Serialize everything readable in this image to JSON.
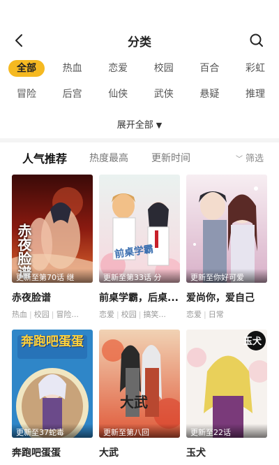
{
  "header": {
    "title": "分类",
    "back_icon": "chevron-left-icon",
    "search_icon": "search-icon"
  },
  "categories": {
    "row1": [
      "全部",
      "热血",
      "恋爱",
      "校园",
      "百合",
      "彩虹"
    ],
    "row2": [
      "冒险",
      "后宫",
      "仙侠",
      "武侠",
      "悬疑",
      "推理"
    ],
    "active": "全部",
    "active_color": "#f5b921"
  },
  "expand": {
    "label": "展开全部",
    "icon": "triangle-down-icon"
  },
  "sort": {
    "tabs": [
      "人气推荐",
      "热度最高",
      "更新时间"
    ],
    "active": "人气推荐",
    "filter_label": "筛选",
    "filter_icon": "chevron-down-icon"
  },
  "comics": [
    {
      "title": "赤夜脸谱",
      "caption": "更新至第70话 继",
      "tags": [
        "热血",
        "校园",
        "冒险..."
      ],
      "cover_text": "赤夜脸谱"
    },
    {
      "title": "前桌学霸，后桌...",
      "caption": "更新至第33话 分",
      "tags": [
        "恋爱",
        "校园",
        "搞笑..."
      ],
      "cover_text": "前桌学霸"
    },
    {
      "title": "爱尚你，爱自己",
      "caption": "更新至你好可爱",
      "tags": [
        "恋爱",
        "日常"
      ],
      "cover_text": ""
    },
    {
      "title": "奔跑吧蛋蛋",
      "caption": "更新至37蛇毒",
      "tags": [],
      "cover_text": "奔跑吧蛋蛋"
    },
    {
      "title": "大武",
      "caption": "更新至第八回",
      "tags": [],
      "cover_text": "大武"
    },
    {
      "title": "玉犬",
      "caption": "更新至22话",
      "tags": [],
      "cover_text": "玉犬"
    }
  ]
}
